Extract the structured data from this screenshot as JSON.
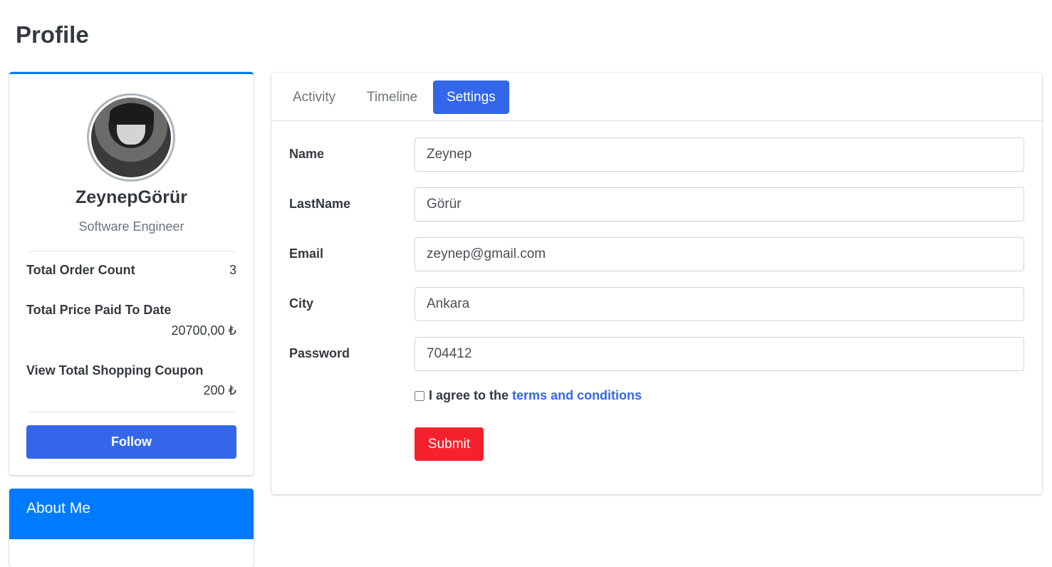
{
  "page": {
    "title": "Profile"
  },
  "profile": {
    "name": "ZeynepGörür",
    "role": "Software Engineer",
    "stats": [
      {
        "label": "Total Order Count",
        "value": "3"
      },
      {
        "label": "Total Price Paid To Date",
        "value": "20700,00 ₺"
      },
      {
        "label": "View Total Shopping Coupon",
        "value": "200 ₺"
      }
    ],
    "follow_label": "Follow"
  },
  "about": {
    "title": "About Me"
  },
  "tabs": [
    {
      "label": "Activity",
      "active": false
    },
    {
      "label": "Timeline",
      "active": false
    },
    {
      "label": "Settings",
      "active": true
    }
  ],
  "form": {
    "fields": [
      {
        "label": "Name",
        "value": "Zeynep"
      },
      {
        "label": "LastName",
        "value": "Görür"
      },
      {
        "label": "Email",
        "value": "zeynep@gmail.com"
      },
      {
        "label": "City",
        "value": "Ankara"
      },
      {
        "label": "Password",
        "value": "704412"
      }
    ],
    "agree_text": "I agree to the",
    "terms_link": "terms and conditions",
    "agree_checked": false,
    "submit_label": "Submit"
  },
  "colors": {
    "primary": "#3366e8",
    "card_accent": "#007bff",
    "submit": "#f5222d"
  }
}
